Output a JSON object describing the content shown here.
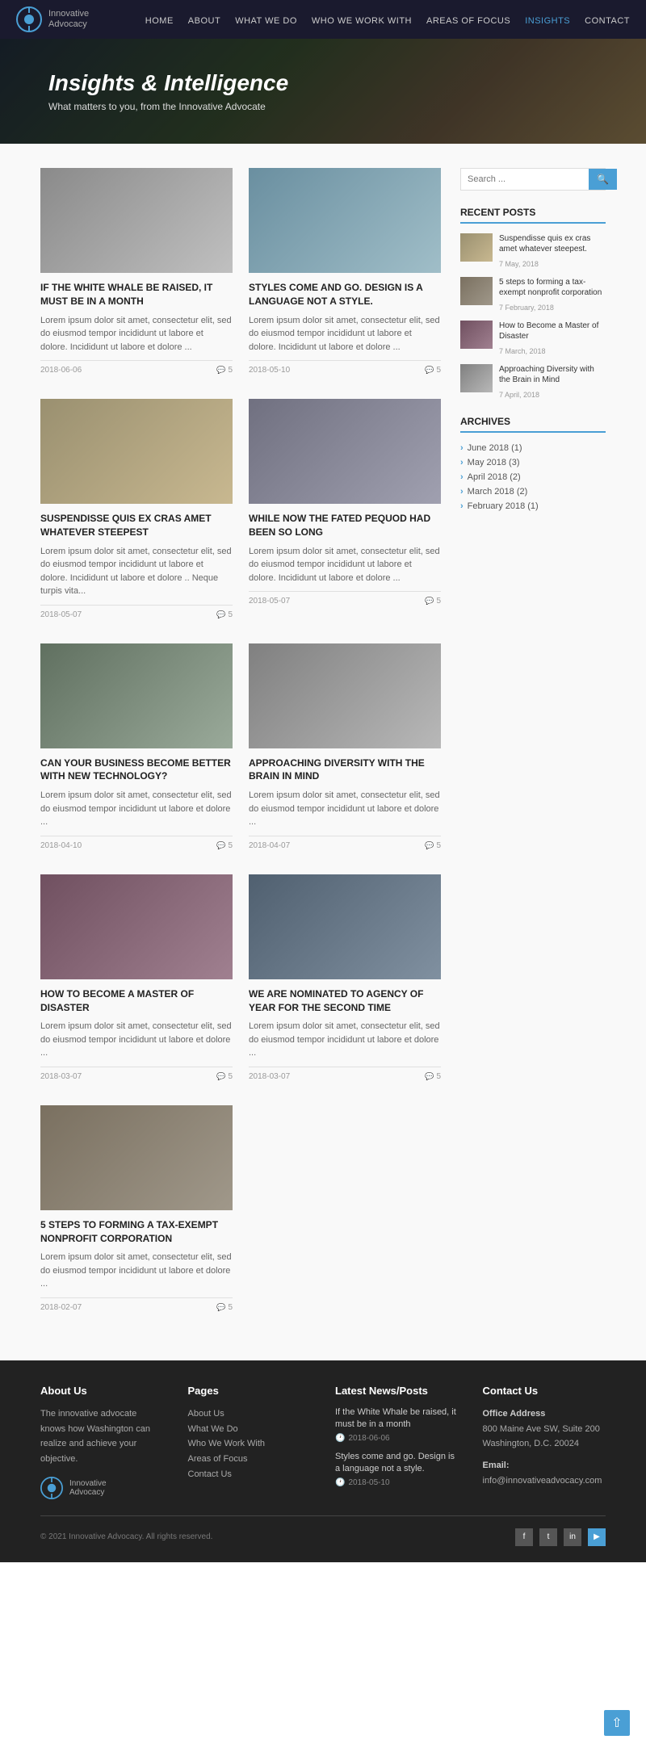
{
  "nav": {
    "logo_line1": "Innovative",
    "logo_line2": "Advocacy",
    "links": [
      {
        "label": "HOME",
        "active": false
      },
      {
        "label": "ABOUT",
        "active": false
      },
      {
        "label": "WHAT WE DO",
        "active": false
      },
      {
        "label": "WHO WE WORK WITH",
        "active": false
      },
      {
        "label": "AREAS OF FOCUS",
        "active": false
      },
      {
        "label": "INSIGHTS",
        "active": true
      },
      {
        "label": "CONTACT",
        "active": false
      }
    ]
  },
  "hero": {
    "title": "Insights & Intelligence",
    "subtitle": "What matters to you, from the Innovative Advocate"
  },
  "search": {
    "placeholder": "Search ..."
  },
  "sidebar": {
    "recent_posts_heading": "RECENT POSTS",
    "archives_heading": "Archives",
    "recent_posts": [
      {
        "title": "Suspendisse quis ex cras amet whatever steepest.",
        "date": "7 May, 2018"
      },
      {
        "title": "5 steps to forming a tax-exempt nonprofit corporation",
        "date": "7 February, 2018"
      },
      {
        "title": "How to Become a Master of Disaster",
        "date": "7 March, 2018"
      },
      {
        "title": "Approaching Diversity with the Brain in Mind",
        "date": "7 April, 2018"
      }
    ],
    "archives": [
      {
        "label": "June 2018 (1)"
      },
      {
        "label": "May 2018 (3)"
      },
      {
        "label": "April 2018 (2)"
      },
      {
        "label": "March 2018 (2)"
      },
      {
        "label": "February 2018 (1)"
      }
    ]
  },
  "posts": [
    {
      "id": 1,
      "title": "IF THE WHITE WHALE BE RAISED, IT MUST BE IN A MONTH",
      "excerpt": "Lorem ipsum dolor sit amet, consectetur elit, sed do eiusmod tempor incididunt ut labore et dolore. Incididunt ut labore et dolore ...",
      "date": "2018-06-06",
      "comments": 5,
      "img_class": "img-1"
    },
    {
      "id": 2,
      "title": "STYLES COME AND GO. DESIGN IS A LANGUAGE NOT A STYLE.",
      "excerpt": "Lorem ipsum dolor sit amet, consectetur elit, sed do eiusmod tempor incididunt ut labore et dolore. Incididunt ut labore et dolore ...",
      "date": "2018-05-10",
      "comments": 5,
      "img_class": "img-2"
    },
    {
      "id": 3,
      "title": "SUSPENDISSE QUIS EX CRAS AMET WHATEVER STEEPEST",
      "excerpt": "Lorem ipsum dolor sit amet, consectetur elit, sed do eiusmod tempor incididunt ut labore et dolore. Incididunt ut labore et dolore .. Neque turpis vita...",
      "date": "2018-05-07",
      "comments": 5,
      "img_class": "img-3"
    },
    {
      "id": 4,
      "title": "WHILE NOW THE FATED PEQUOD HAD BEEN SO LONG",
      "excerpt": "Lorem ipsum dolor sit amet, consectetur elit, sed do eiusmod tempor incididunt ut labore et dolore. Incididunt ut labore et dolore ...",
      "date": "2018-05-07",
      "comments": 5,
      "img_class": "img-4"
    },
    {
      "id": 5,
      "title": "CAN YOUR BUSINESS BECOME BETTER WITH NEW TECHNOLOGY?",
      "excerpt": "Lorem ipsum dolor sit amet, consectetur elit, sed do eiusmod tempor incididunt ut labore et dolore ...",
      "date": "2018-04-10",
      "comments": 5,
      "img_class": "img-5"
    },
    {
      "id": 6,
      "title": "APPROACHING DIVERSITY WITH THE BRAIN IN MIND",
      "excerpt": "Lorem ipsum dolor sit amet, consectetur elit, sed do eiusmod tempor incididunt ut labore et dolore ...",
      "date": "2018-04-07",
      "comments": 5,
      "img_class": "img-6"
    },
    {
      "id": 7,
      "title": "HOW TO BECOME A MASTER OF DISASTER",
      "excerpt": "Lorem ipsum dolor sit amet, consectetur elit, sed do eiusmod tempor incididunt ut labore et dolore ...",
      "date": "2018-03-07",
      "comments": 5,
      "img_class": "img-7"
    },
    {
      "id": 8,
      "title": "WE ARE NOMINATED TO AGENCY OF YEAR FOR THE SECOND TIME",
      "excerpt": "Lorem ipsum dolor sit amet, consectetur elit, sed do eiusmod tempor incididunt ut labore et dolore ...",
      "date": "2018-03-07",
      "comments": 5,
      "img_class": "img-8"
    },
    {
      "id": 9,
      "title": "5 STEPS TO FORMING A TAX-EXEMPT NONPROFIT CORPORATION",
      "excerpt": "Lorem ipsum dolor sit amet, consectetur elit, sed do eiusmod tempor incididunt ut labore et dolore ...",
      "date": "2018-02-07",
      "comments": 5,
      "img_class": "img-9",
      "single": true
    }
  ],
  "footer": {
    "about_heading": "About Us",
    "about_text": "The innovative advocate knows how Washington can realize and achieve your objective.",
    "pages_heading": "Pages",
    "pages_links": [
      "About Us",
      "What We Do",
      "Who We Work With",
      "Areas of Focus",
      "Contact Us"
    ],
    "news_heading": "Latest News/Posts",
    "news_items": [
      {
        "title": "If the White Whale be raised, it must be in a month",
        "date": "2018-06-06"
      },
      {
        "title": "Styles come and go. Design is a language not a style.",
        "date": "2018-05-10"
      }
    ],
    "contact_heading": "Contact Us",
    "contact_address_label": "Office Address",
    "contact_address": "800 Maine Ave SW, Suite 200\nWashington, D.C. 20024",
    "contact_email_label": "Email:",
    "contact_email": "info@innovativeadvocacy.com",
    "copyright": "© 2021 Innovative Advocacy. All rights reserved.",
    "logo_line1": "Innovative",
    "logo_line2": "Advocacy",
    "social": [
      "f",
      "t",
      "in",
      "🔷"
    ]
  }
}
